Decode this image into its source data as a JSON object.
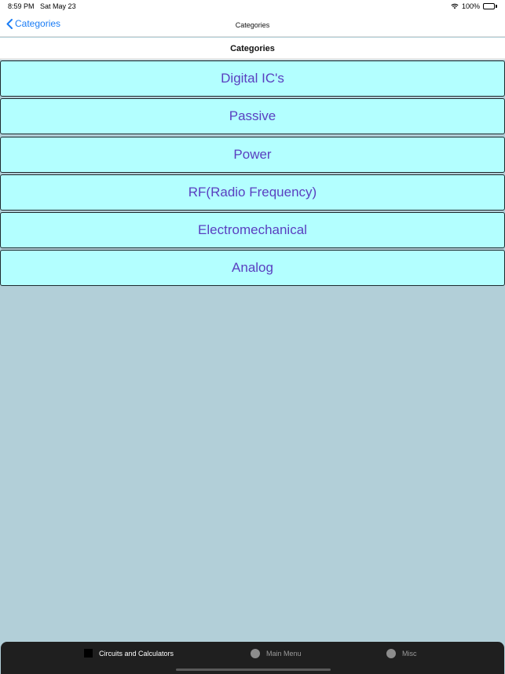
{
  "status": {
    "time": "8:59 PM",
    "date": "Sat May 23",
    "battery": "100%"
  },
  "nav": {
    "back_label": "Categories",
    "title": "Categories"
  },
  "section": {
    "title": "Categories"
  },
  "categories": [
    {
      "label": "Digital IC's"
    },
    {
      "label": "Passive"
    },
    {
      "label": "Power"
    },
    {
      "label": "RF(Radio Frequency)"
    },
    {
      "label": "Electromechanical"
    },
    {
      "label": "Analog"
    }
  ],
  "tabs": [
    {
      "label": "Circuits and Calculators",
      "icon": "square-icon"
    },
    {
      "label": "Main Menu",
      "icon": "circle-icon"
    },
    {
      "label": "Misc",
      "icon": "circle-icon"
    }
  ],
  "colors": {
    "accent": "#1a7cf5",
    "cell_bg": "#b3ffff",
    "cell_text": "#5a3fc0",
    "background": "#b2cfd8",
    "tab_bar": "#1f1f1f"
  }
}
